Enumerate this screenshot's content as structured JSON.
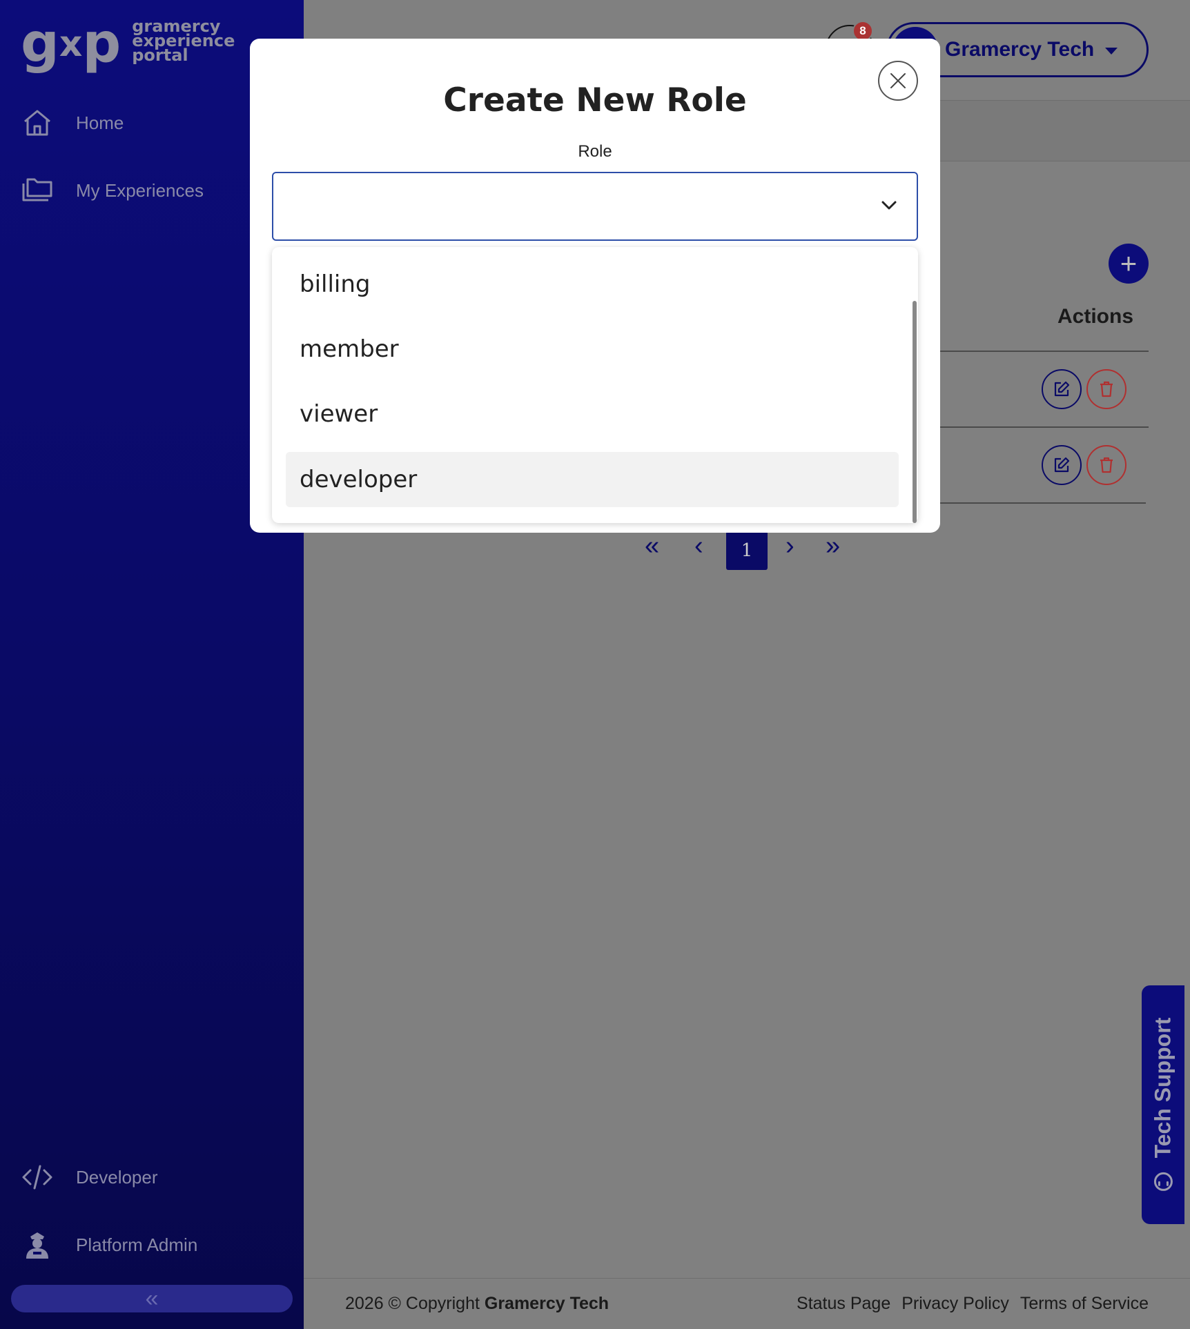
{
  "sidebar": {
    "logo_mark": "gxp",
    "logo_lines": [
      "gramercy",
      "experience",
      "portal"
    ],
    "items_top": [
      {
        "label": "Home",
        "icon": "home-icon"
      },
      {
        "label": "My Experiences",
        "icon": "folders-icon"
      }
    ],
    "items_bottom": [
      {
        "label": "Developer",
        "icon": "code-icon"
      },
      {
        "label": "Platform Admin",
        "icon": "admin-agent-icon"
      }
    ],
    "collapse_glyph": "«"
  },
  "header": {
    "notification_count": "8",
    "user_name": "Gramercy Tech"
  },
  "table": {
    "actions_header": "Actions",
    "add_glyph": "+"
  },
  "pagination": {
    "first": "«",
    "prev": "‹",
    "current": "1",
    "next": "›",
    "last": "»"
  },
  "tech_support": {
    "label": "Tech Support"
  },
  "footer": {
    "copyright_prefix": "2026 © Copyright ",
    "copyright_brand": "Gramercy Tech",
    "links": [
      "Status Page",
      "Privacy Policy",
      "Terms of Service"
    ]
  },
  "modal": {
    "title": "Create New Role",
    "field_label": "Role",
    "selected_value": "",
    "options": [
      "billing",
      "member",
      "viewer",
      "developer"
    ],
    "hovered_option": "developer"
  },
  "colors": {
    "sidebar_bg": "#0c0c7a",
    "brand_navy": "#0a0a66",
    "danger": "#b03030",
    "overlay": "#808080",
    "select_border": "#2d4ea8"
  }
}
